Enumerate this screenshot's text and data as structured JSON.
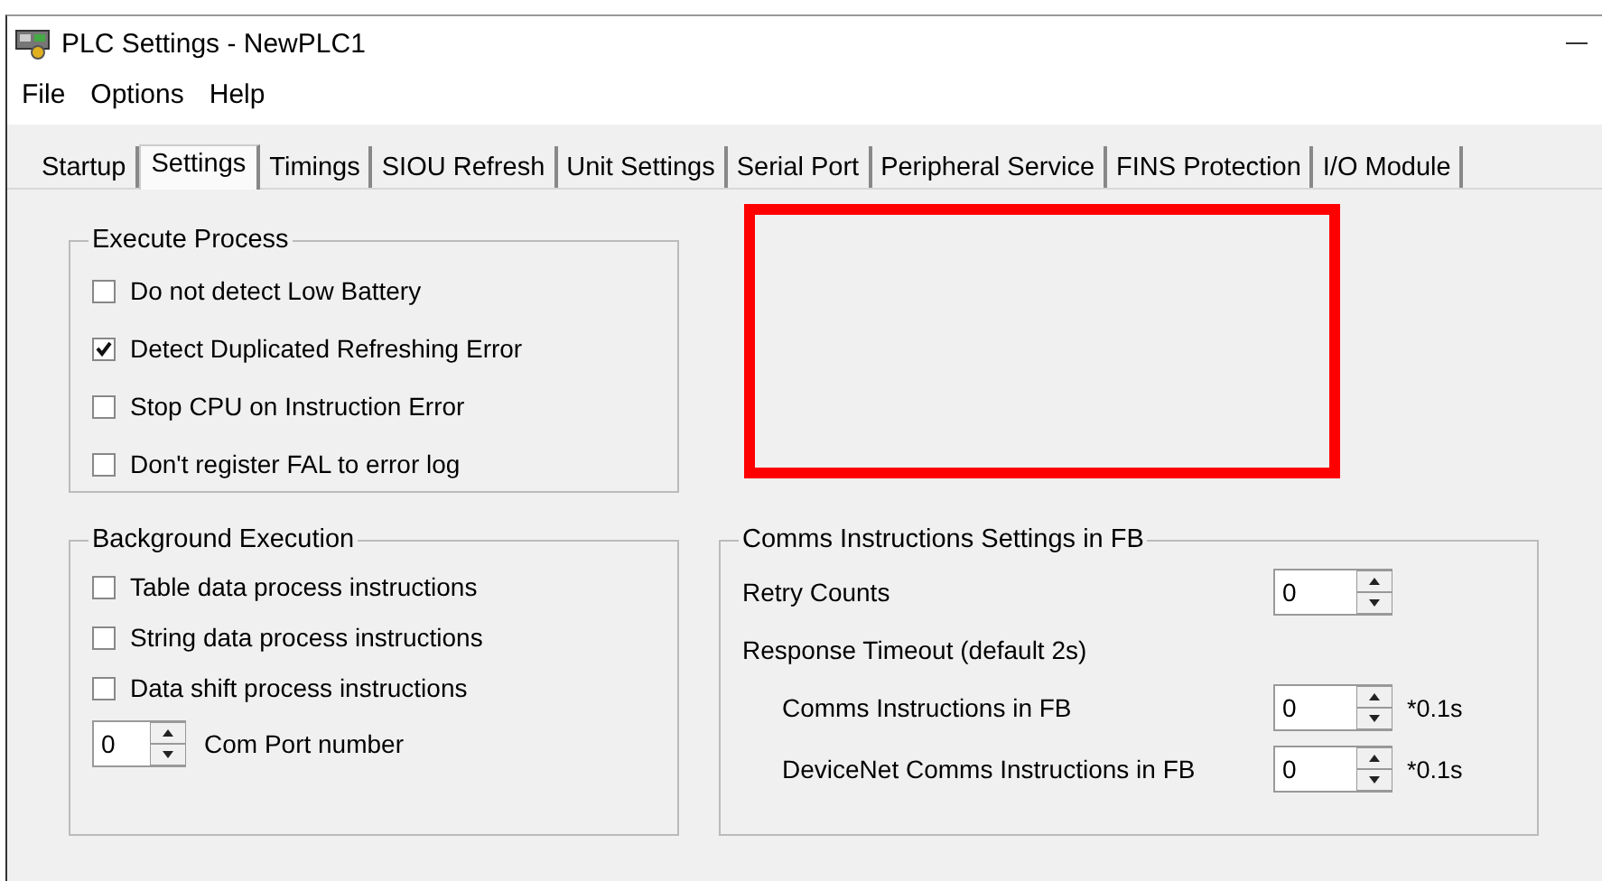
{
  "window": {
    "title": "PLC Settings - NewPLC1"
  },
  "menu": [
    "File",
    "Options",
    "Help"
  ],
  "tabs": [
    {
      "label": "Startup",
      "selected": false
    },
    {
      "label": "Settings",
      "selected": true
    },
    {
      "label": "Timings",
      "selected": false
    },
    {
      "label": "SIOU Refresh",
      "selected": false
    },
    {
      "label": "Unit Settings",
      "selected": false
    },
    {
      "label": "Serial Port",
      "selected": false
    },
    {
      "label": "Peripheral Service",
      "selected": false
    },
    {
      "label": "FINS Protection",
      "selected": false
    },
    {
      "label": "I/O Module",
      "selected": false
    }
  ],
  "execute_process": {
    "title": "Execute Process",
    "options": [
      {
        "label": "Do not detect Low Battery",
        "checked": false
      },
      {
        "label": "Detect Duplicated Refreshing Error",
        "checked": true
      },
      {
        "label": "Stop CPU on Instruction Error",
        "checked": false
      },
      {
        "label": "Don't register FAL to error log",
        "checked": false
      }
    ]
  },
  "background_execution": {
    "title": "Background Execution",
    "options": [
      {
        "label": "Table data process instructions",
        "checked": false
      },
      {
        "label": "String data process instructions",
        "checked": false
      },
      {
        "label": "Data shift process instructions",
        "checked": false
      }
    ],
    "com_port": {
      "value": "0",
      "label": "Com Port number"
    }
  },
  "comms_settings": {
    "title": "Comms Instructions Settings in FB",
    "rows": [
      {
        "kind": "spin",
        "label": "Retry Counts",
        "value": "0"
      },
      {
        "kind": "heading",
        "label": "Response Timeout (default 2s)",
        "children": [
          {
            "kind": "spin",
            "label": "Comms Instructions in FB",
            "value": "0",
            "unit": "*0.1s"
          },
          {
            "kind": "spin",
            "label": "DeviceNet Comms Instructions in FB",
            "value": "0",
            "unit": "*0.1s"
          }
        ]
      }
    ]
  }
}
